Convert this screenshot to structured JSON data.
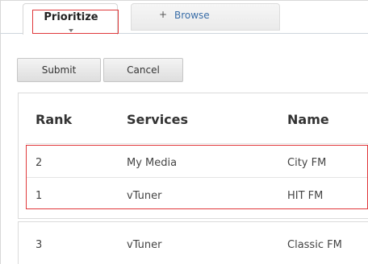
{
  "tabs": {
    "prioritize": "Prioritize",
    "browse_prefix": "+",
    "browse": "Browse"
  },
  "toolbar": {
    "submit": "Submit",
    "cancel": "Cancel"
  },
  "table": {
    "headers": {
      "rank": "Rank",
      "services": "Services",
      "name": "Name"
    },
    "rows": [
      {
        "rank": "2",
        "service": "My Media",
        "name": "City FM"
      },
      {
        "rank": "1",
        "service": "vTuner",
        "name": "HIT FM"
      },
      {
        "rank": "3",
        "service": "vTuner",
        "name": "Classic FM"
      }
    ]
  },
  "colors": {
    "highlight": "#e0383b",
    "link": "#3a6ea8"
  }
}
